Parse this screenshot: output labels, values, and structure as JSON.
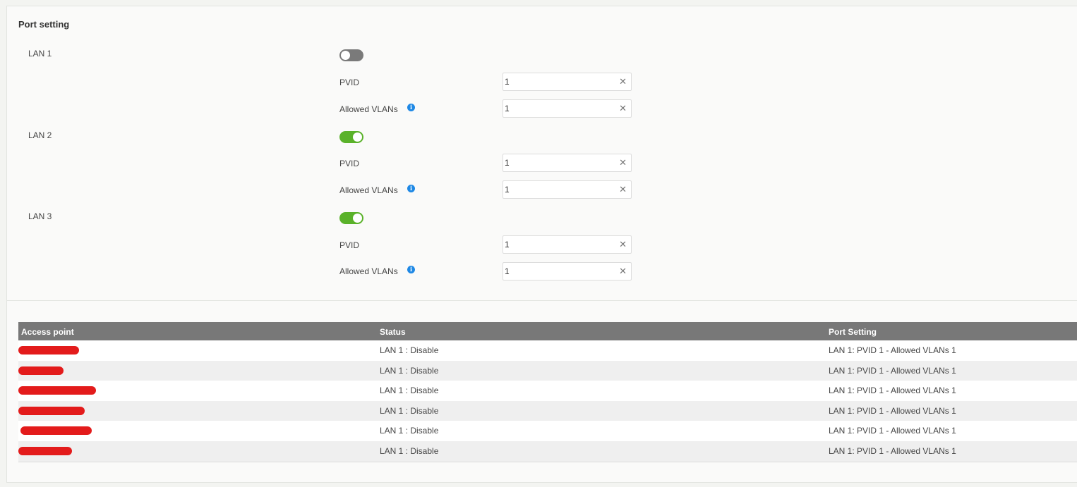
{
  "section": {
    "title": "Port setting"
  },
  "ports": [
    {
      "name": "LAN 1",
      "enabled": false,
      "pvid_label": "PVID",
      "pvid": "1",
      "vlans_label": "Allowed VLANs",
      "vlans": "1"
    },
    {
      "name": "LAN 2",
      "enabled": true,
      "pvid_label": "PVID",
      "pvid": "1",
      "vlans_label": "Allowed VLANs",
      "vlans": "1"
    },
    {
      "name": "LAN 3",
      "enabled": true,
      "pvid_label": "PVID",
      "pvid": "1",
      "vlans_label": "Allowed VLANs",
      "vlans": "1"
    }
  ],
  "icons": {
    "info": "info-icon",
    "clear": "close-icon",
    "info_glyph": "i",
    "clear_glyph": "✕"
  },
  "colors": {
    "toggle_on": "#5ab22a",
    "toggle_off": "#7a7a7a",
    "info": "#1e88e5",
    "header_bg": "#787878",
    "redaction": "#e31b1b"
  },
  "table": {
    "columns": [
      "Access point",
      "Status",
      "Port Setting"
    ],
    "rows": [
      {
        "access_point": "",
        "status": "LAN 1 : Disable",
        "port_setting": "LAN 1: PVID 1 - Allowed VLANs 1"
      },
      {
        "access_point": "",
        "status": "LAN 1 : Disable",
        "port_setting": "LAN 1: PVID 1 - Allowed VLANs 1"
      },
      {
        "access_point": "",
        "status": "LAN 1 : Disable",
        "port_setting": "LAN 1: PVID 1 - Allowed VLANs 1"
      },
      {
        "access_point": "",
        "status": "LAN 1 : Disable",
        "port_setting": "LAN 1: PVID 1 - Allowed VLANs 1"
      },
      {
        "access_point": "",
        "status": "LAN 1 : Disable",
        "port_setting": "LAN 1: PVID 1 - Allowed VLANs 1"
      },
      {
        "access_point": "",
        "status": "LAN 1 : Disable",
        "port_setting": "LAN 1: PVID 1 - Allowed VLANs 1"
      }
    ]
  }
}
